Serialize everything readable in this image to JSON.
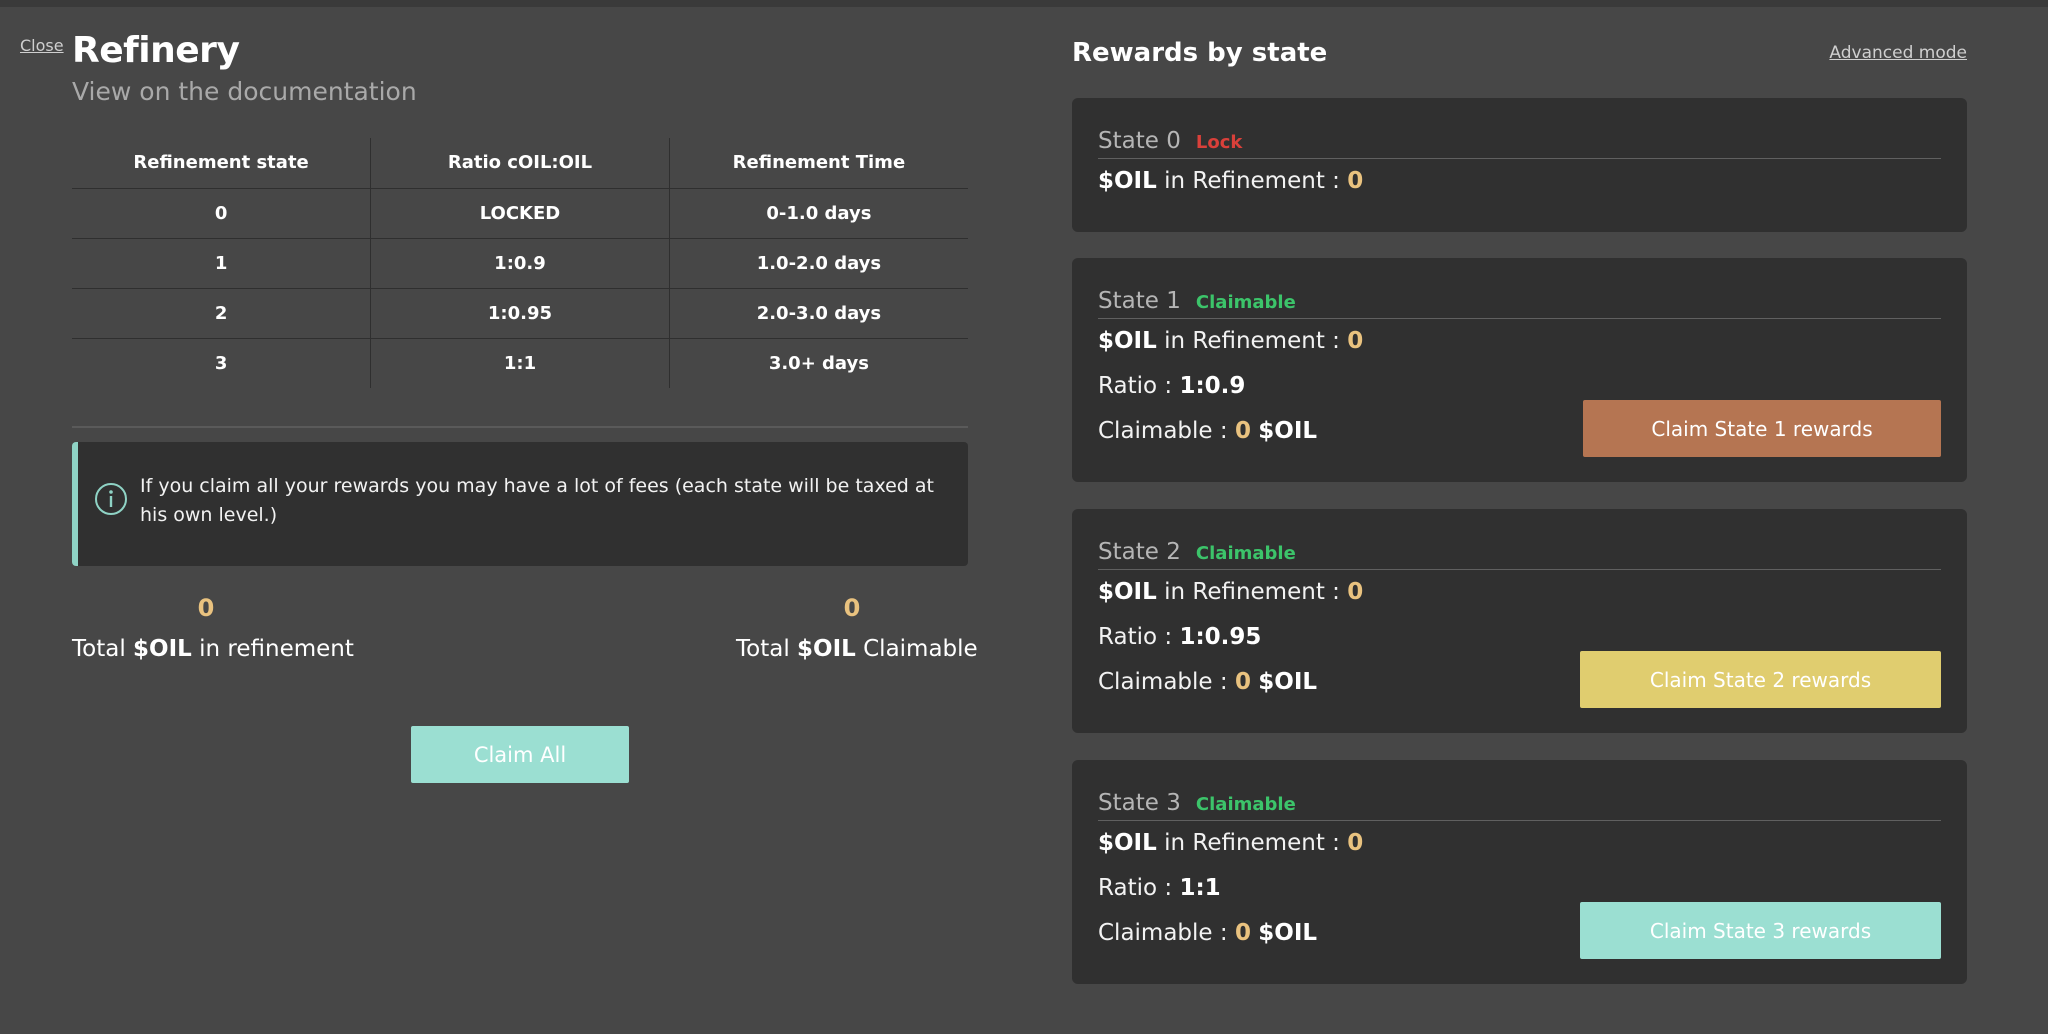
{
  "header": {
    "close_label": "Close",
    "title": "Refinery",
    "doc_link": "View on the documentation"
  },
  "table": {
    "columns": [
      "Refinement state",
      "Ratio cOIL:OIL",
      "Refinement Time"
    ],
    "rows": [
      [
        "0",
        "LOCKED",
        "0-1.0 days"
      ],
      [
        "1",
        "1:0.9",
        "1.0-2.0 days"
      ],
      [
        "2",
        "1:0.95",
        "2.0-3.0 days"
      ],
      [
        "3",
        "1:1",
        "3.0+ days"
      ]
    ]
  },
  "notice": {
    "icon": "info-icon",
    "text": "If you claim all your rewards you may have a lot of fees (each state will be taxed at his own level.)"
  },
  "totals": {
    "refinement_value": "0",
    "refinement_prefix": "Total",
    "refinement_token": "$OIL",
    "refinement_suffix": "in refinement",
    "claimable_value": "0",
    "claimable_prefix": "Total",
    "claimable_token": "$OIL",
    "claimable_suffix": "Claimable"
  },
  "claim_all_label": "Claim All",
  "rewards": {
    "title": "Rewards by state",
    "advanced_label": "Advanced mode",
    "labels": {
      "token": "$OIL",
      "in_refinement": "in Refinement :",
      "ratio": "Ratio :",
      "claimable": "Claimable :"
    },
    "states": [
      {
        "name": "State 0",
        "badge": "Lock",
        "refinement": "0"
      },
      {
        "name": "State 1",
        "badge": "Claimable",
        "refinement": "0",
        "ratio": "1:0.9",
        "claimable": "0",
        "button": "Claim State 1 rewards"
      },
      {
        "name": "State 2",
        "badge": "Claimable",
        "refinement": "0",
        "ratio": "1:0.95",
        "claimable": "0",
        "button": "Claim State 2 rewards"
      },
      {
        "name": "State 3",
        "badge": "Claimable",
        "refinement": "0",
        "ratio": "1:1",
        "claimable": "0",
        "button": "Claim State 3 rewards"
      }
    ]
  },
  "colors": {
    "background": "#474747",
    "panel": "#303030",
    "accent_teal": "#9bdfd2",
    "claim_state_1": "#b57552",
    "claim_state_2": "#e0cd6f",
    "claim_state_3": "#9bdfd2",
    "value_gold": "#e9c27f",
    "lock_red": "#d9403a",
    "claimable_green": "#3cc46a"
  }
}
